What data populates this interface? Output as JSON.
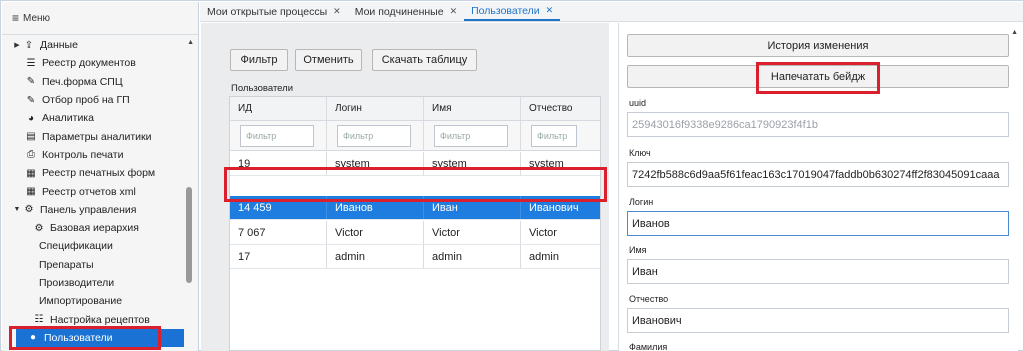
{
  "sidebar": {
    "menu_label": "Меню",
    "items": [
      {
        "label": "Данные",
        "icon": "upload-icon",
        "arrow": "right"
      },
      {
        "label": "Реестр документов",
        "icon": "list-icon"
      },
      {
        "label": "Печ.форма СПЦ",
        "icon": "pen-icon"
      },
      {
        "label": "Отбор проб на ГП",
        "icon": "pen-icon"
      },
      {
        "label": "Аналитика",
        "icon": "pie-chart-icon"
      },
      {
        "label": "Параметры аналитики",
        "icon": "settings-box-icon"
      },
      {
        "label": "Контроль печати",
        "icon": "printer-icon"
      },
      {
        "label": "Реестр печатных форм",
        "icon": "table-icon"
      },
      {
        "label": "Реестр отчетов xml",
        "icon": "table-icon"
      },
      {
        "label": "Панель управления",
        "icon": "gears-icon",
        "arrow": "down"
      },
      {
        "label": "Базовая иерархия",
        "icon": "gears-icon"
      },
      {
        "label": "Спецификации"
      },
      {
        "label": "Препараты"
      },
      {
        "label": "Производители"
      },
      {
        "label": "Импортирование"
      },
      {
        "label": "Настройка рецептов",
        "icon": "sliders-icon"
      },
      {
        "label": "Пользователи",
        "icon": "user-icon",
        "active": true
      }
    ]
  },
  "tabs": [
    {
      "label": "Мои открытые процессы"
    },
    {
      "label": "Мои подчиненные"
    },
    {
      "label": "Пользователи",
      "active": true
    }
  ],
  "toolbar": {
    "filter_label": "Фильтр",
    "cancel_label": "Отменить",
    "download_label": "Скачать таблицу"
  },
  "users_label": "Пользователи",
  "grid": {
    "columns": [
      "ИД",
      "Логин",
      "Имя",
      "Отчество"
    ],
    "filter_placeholder": "Фильтр",
    "rows": [
      {
        "id": "19",
        "login": "system",
        "name": "system",
        "patronymic": "system"
      },
      {
        "id": "14 459",
        "login": "Иванов",
        "name": "Иван",
        "patronymic": "Иванович",
        "selected": true
      },
      {
        "id": "7 067",
        "login": "Victor",
        "name": "Victor",
        "patronymic": "Victor"
      },
      {
        "id": "17",
        "login": "admin",
        "name": "admin",
        "patronymic": "admin"
      }
    ]
  },
  "details": {
    "history_label": "История изменения",
    "print_badge_label": "Напечатать бейдж",
    "uuid_label": "uuid",
    "uuid_value": "25943016f9338e9286ca1790923f4f1b",
    "key_label": "Ключ",
    "key_value": "7242fb588c6d9aa5f61feac163c17019047faddb0b630274ff2f83045091caaa",
    "login_label": "Логин",
    "login_value": "Иванов",
    "name_label": "Имя",
    "name_value": "Иван",
    "patronymic_label": "Отчество",
    "patronymic_value": "Иванович",
    "surname_label": "Фамилия"
  },
  "colors": {
    "accent": "#1f73c8",
    "selection": "#1f7de0",
    "highlight_box": "#d9202c"
  }
}
